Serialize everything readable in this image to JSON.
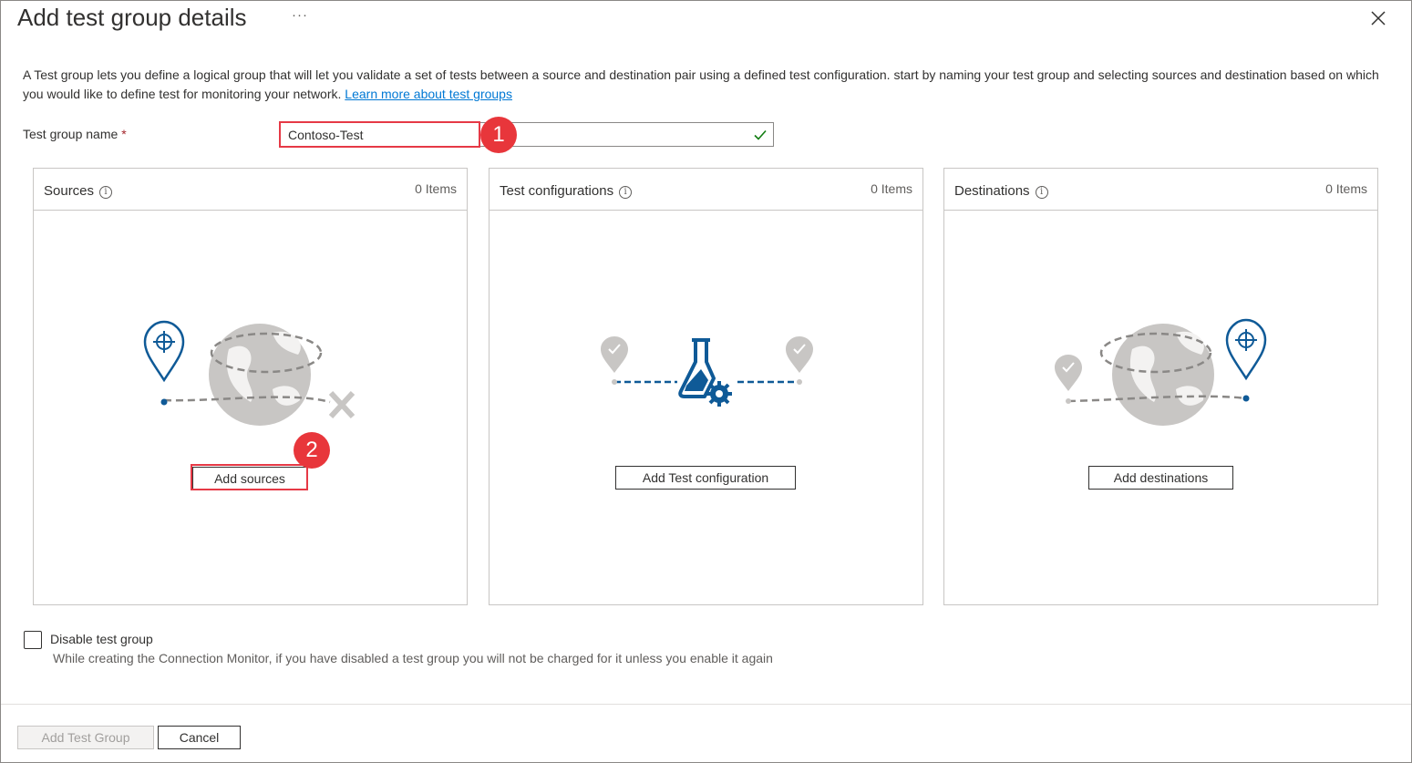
{
  "header": {
    "title": "Add test group details",
    "more_label": "···"
  },
  "description": {
    "text": "A Test group lets you define a logical group that will let you validate a set of tests between a source and destination pair using a defined test configuration. start by naming your test group and selecting sources and destination based on which you would like to define test for monitoring your network.",
    "link": "Learn more about test groups"
  },
  "form": {
    "name_label": "Test group name",
    "required_mark": "*",
    "name_value": "Contoso-Test"
  },
  "cards": {
    "sources": {
      "title": "Sources",
      "count": "0 Items",
      "button": "Add sources"
    },
    "test_configurations": {
      "title": "Test configurations",
      "count": "0 Items",
      "button": "Add Test configuration"
    },
    "destinations": {
      "title": "Destinations",
      "count": "0 Items",
      "button": "Add destinations"
    }
  },
  "disable": {
    "label": "Disable test group",
    "help": "While creating the Connection Monitor, if you have disabled a test group you will not be charged for it unless you enable it again",
    "checked": false
  },
  "footer": {
    "add_label": "Add Test Group",
    "cancel_label": "Cancel"
  },
  "annotations": {
    "step1": "1",
    "step2": "2"
  },
  "colors": {
    "accent_blue": "#0078d4",
    "icon_blue": "#0f5a97",
    "highlight_red": "#e63946",
    "required_red": "#a4262c",
    "success_green": "#107c10"
  }
}
